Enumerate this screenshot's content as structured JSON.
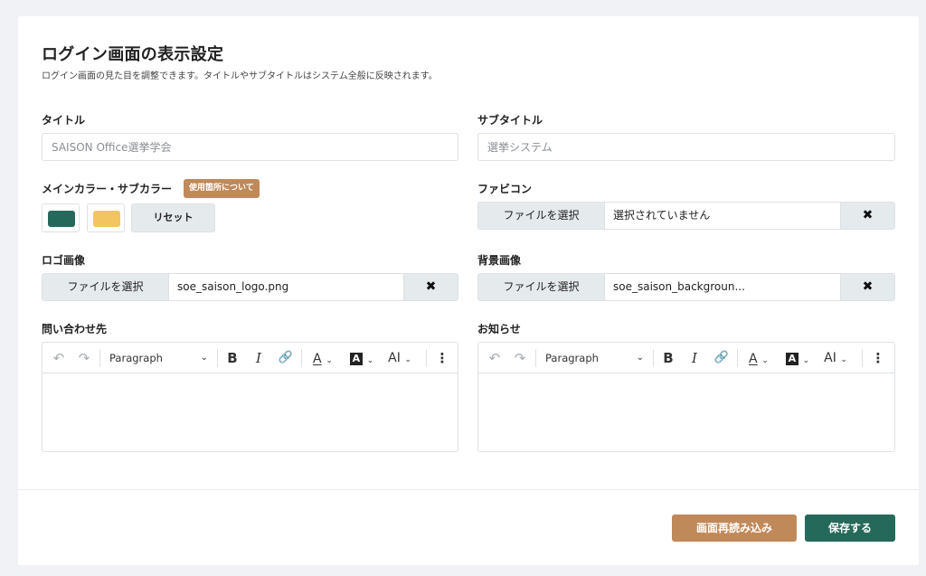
{
  "page": {
    "title": "ログイン画面の表示設定",
    "description": "ログイン画面の見た目を調整できます。タイトルやサブタイトルはシステム全般に反映されます。"
  },
  "fields": {
    "title": {
      "label": "タイトル",
      "placeholder": "SAISON Office選挙学会",
      "value": ""
    },
    "subtitle": {
      "label": "サブタイトル",
      "placeholder": "選挙システム",
      "value": ""
    },
    "colors": {
      "label": "メインカラー・サブカラー",
      "badge": "使用箇所について",
      "main_color": "#25695a",
      "sub_color": "#f3c560",
      "reset_label": "リセット"
    },
    "favicon": {
      "label": "ファビコン",
      "select_label": "ファイルを選択",
      "file_name": "選択されていません",
      "clear_icon": "✖"
    },
    "logo": {
      "label": "ロゴ画像",
      "select_label": "ファイルを選択",
      "file_name": "soe_saison_logo.png",
      "clear_icon": "✖"
    },
    "background": {
      "label": "背景画像",
      "select_label": "ファイルを選択",
      "file_name": "soe_saison_backgroun...",
      "clear_icon": "✖"
    },
    "contact": {
      "label": "問い合わせ先"
    },
    "notice": {
      "label": "お知らせ"
    }
  },
  "editor_toolbar": {
    "undo_icon": "↶",
    "redo_icon": "↷",
    "paragraph": "Paragraph",
    "bold": "B",
    "italic": "I",
    "link_icon": "🔗",
    "font_color": "A",
    "highlight": "A",
    "ai": "AI",
    "more_icon": "⋮",
    "chevron_icon": "⌄"
  },
  "footer": {
    "reload_label": "画面再読み込み",
    "save_label": "保存する"
  },
  "colors": {
    "accent_brown": "#c0895a",
    "accent_green": "#25695a"
  }
}
